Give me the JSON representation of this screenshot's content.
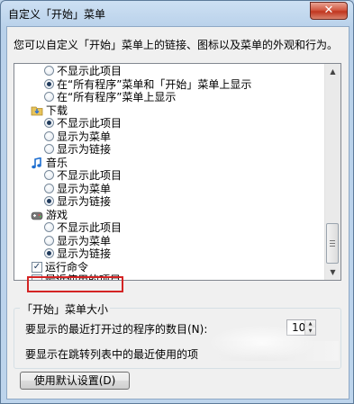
{
  "window": {
    "title": "自定义「开始」菜单",
    "close_glyph": "✕"
  },
  "description": "您可以自定义「开始」菜单上的链接、图标以及菜单的外观和行为。",
  "list": {
    "rows": [
      {
        "kind": "radio",
        "label": "不显示此项目",
        "checked": false
      },
      {
        "kind": "radio",
        "label": "在“所有程序”菜单和「开始」菜单上显示",
        "checked": true
      },
      {
        "kind": "radio",
        "label": "在“所有程序”菜单上显示",
        "checked": false
      },
      {
        "kind": "category",
        "label": "下载",
        "icon": "download-folder-icon"
      },
      {
        "kind": "radio",
        "label": "不显示此项目",
        "checked": true
      },
      {
        "kind": "radio",
        "label": "显示为菜单",
        "checked": false
      },
      {
        "kind": "radio",
        "label": "显示为链接",
        "checked": false
      },
      {
        "kind": "category",
        "label": "音乐",
        "icon": "music-note-icon"
      },
      {
        "kind": "radio",
        "label": "不显示此项目",
        "checked": false
      },
      {
        "kind": "radio",
        "label": "显示为菜单",
        "checked": false
      },
      {
        "kind": "radio",
        "label": "显示为链接",
        "checked": true
      },
      {
        "kind": "category",
        "label": "游戏",
        "icon": "games-icon"
      },
      {
        "kind": "radio",
        "label": "不显示此项目",
        "checked": false
      },
      {
        "kind": "radio",
        "label": "显示为菜单",
        "checked": false
      },
      {
        "kind": "radio",
        "label": "显示为链接",
        "checked": true
      },
      {
        "kind": "checkbox",
        "label": "运行命令",
        "checked": true
      },
      {
        "kind": "checkbox",
        "label": "最近使用的项目",
        "checked": false
      }
    ]
  },
  "start_menu_size": {
    "title": "「开始」菜单大小",
    "recent_programs_label": "要显示的最近打开过的程序的数目(N):",
    "recent_programs_value": "10",
    "jump_list_label": "要显示在跳转列表中的最近使用的项"
  },
  "buttons": {
    "use_defaults": "使用默认设置(D)"
  },
  "colors": {
    "highlight_border": "#d42424",
    "title_gradient": "#cde0f3",
    "close_button": "#c0361f"
  }
}
